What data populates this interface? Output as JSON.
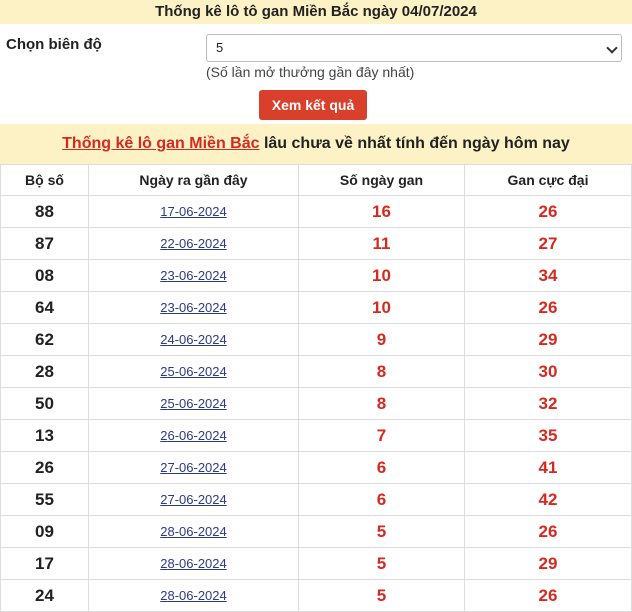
{
  "header": {
    "title": "Thống kê lô tô gan Miền Bắc ngày 04/07/2024"
  },
  "form": {
    "label": "Chọn biên độ",
    "selected": "5",
    "hint": "(Số lần mở thưởng gần đây nhất)",
    "button": "Xem kết quả"
  },
  "banner": {
    "link": "Thống kê lô gan Miền Bắc",
    "rest": " lâu chưa về nhất tính đến ngày hôm nay"
  },
  "table": {
    "headers": [
      "Bộ số",
      "Ngày ra gần đây",
      "Số ngày gan",
      "Gan cực đại"
    ],
    "rows": [
      {
        "num": "88",
        "date": "17-06-2024",
        "days": "16",
        "max": "26"
      },
      {
        "num": "87",
        "date": "22-06-2024",
        "days": "11",
        "max": "27"
      },
      {
        "num": "08",
        "date": "23-06-2024",
        "days": "10",
        "max": "34"
      },
      {
        "num": "64",
        "date": "23-06-2024",
        "days": "10",
        "max": "26"
      },
      {
        "num": "62",
        "date": "24-06-2024",
        "days": "9",
        "max": "29"
      },
      {
        "num": "28",
        "date": "25-06-2024",
        "days": "8",
        "max": "30"
      },
      {
        "num": "50",
        "date": "25-06-2024",
        "days": "8",
        "max": "32"
      },
      {
        "num": "13",
        "date": "26-06-2024",
        "days": "7",
        "max": "35"
      },
      {
        "num": "26",
        "date": "27-06-2024",
        "days": "6",
        "max": "41"
      },
      {
        "num": "55",
        "date": "27-06-2024",
        "days": "6",
        "max": "42"
      },
      {
        "num": "09",
        "date": "28-06-2024",
        "days": "5",
        "max": "26"
      },
      {
        "num": "17",
        "date": "28-06-2024",
        "days": "5",
        "max": "29"
      },
      {
        "num": "24",
        "date": "28-06-2024",
        "days": "5",
        "max": "26"
      }
    ]
  }
}
